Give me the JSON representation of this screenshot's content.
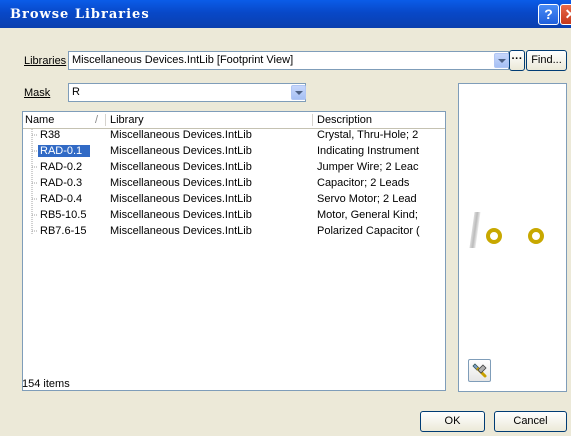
{
  "window": {
    "title": "Browse Libraries",
    "help": "?",
    "close": "✕"
  },
  "libraries": {
    "label": "Libraries",
    "value": "Miscellaneous Devices.IntLib [Footprint View]",
    "ellipsis": "···",
    "find": "Find..."
  },
  "mask": {
    "label": "Mask",
    "value": "R"
  },
  "table": {
    "columns": [
      "Name",
      "Library",
      "Description"
    ],
    "sort_indicator": "/",
    "rows": [
      {
        "name": "R38",
        "library": "Miscellaneous Devices.IntLib",
        "description": "Crystal, Thru-Hole; 2"
      },
      {
        "name": "RAD-0.1",
        "library": "Miscellaneous Devices.IntLib",
        "description": "Indicating Instrument"
      },
      {
        "name": "RAD-0.2",
        "library": "Miscellaneous Devices.IntLib",
        "description": "Jumper Wire; 2 Leac"
      },
      {
        "name": "RAD-0.3",
        "library": "Miscellaneous Devices.IntLib",
        "description": "Capacitor; 2 Leads"
      },
      {
        "name": "RAD-0.4",
        "library": "Miscellaneous Devices.IntLib",
        "description": "Servo Motor; 2 Lead"
      },
      {
        "name": "RB5-10.5",
        "library": "Miscellaneous Devices.IntLib",
        "description": "Motor, General Kind;"
      },
      {
        "name": "RB7.6-15",
        "library": "Miscellaneous Devices.IntLib",
        "description": "Polarized Capacitor ("
      }
    ],
    "selected_row": "RAD-0.1"
  },
  "status": "154 items",
  "buttons": {
    "ok": "OK",
    "cancel": "Cancel"
  },
  "colors": {
    "title_bar": "#0a5ce8",
    "selection": "#316ac5",
    "pad": "#c8a800"
  },
  "icons": {
    "preview_tool": "wrench-icon"
  }
}
